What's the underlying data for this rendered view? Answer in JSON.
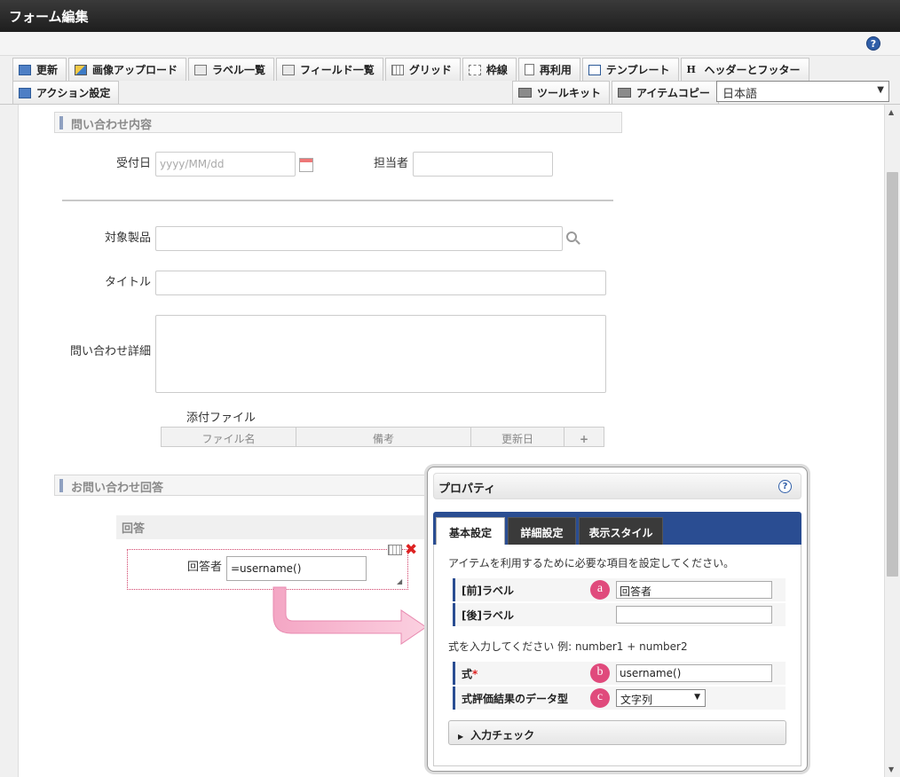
{
  "window": {
    "title": "フォーム編集"
  },
  "toolbar": {
    "row1": [
      {
        "label": "更新",
        "icon": "update-icon"
      },
      {
        "label": "画像アップロード",
        "icon": "image-upload-icon"
      },
      {
        "label": "ラベル一覧",
        "icon": "label-list-icon"
      },
      {
        "label": "フィールド一覧",
        "icon": "field-list-icon"
      },
      {
        "label": "グリッド",
        "icon": "grid-icon"
      },
      {
        "label": "枠線",
        "icon": "border-icon"
      },
      {
        "label": "再利用",
        "icon": "reuse-icon"
      },
      {
        "label": "テンプレート",
        "icon": "template-icon"
      },
      {
        "label": "ヘッダーとフッター",
        "icon": "header-footer-icon"
      }
    ],
    "row2_left": {
      "label": "アクション設定",
      "icon": "action-settings-icon"
    },
    "toolkit": "ツールキット",
    "item_copy": "アイテムコピー",
    "language": "日本語"
  },
  "form": {
    "section1": "問い合わせ内容",
    "received_date_label": "受付日",
    "received_date_placeholder": "yyyy/MM/dd",
    "person_in_charge_label": "担当者",
    "target_product_label": "対象製品",
    "title_label": "タイトル",
    "details_label": "問い合わせ詳細",
    "attachment_label": "添付ファイル",
    "attachment_columns": [
      "ファイル名",
      "備考",
      "更新日"
    ],
    "add_symbol": "+",
    "section2": "お問い合わせ回答",
    "answer_group": "回答",
    "responder_label": "回答者",
    "responder_value": "=username()"
  },
  "properties": {
    "title": "プロパティ",
    "help": "?",
    "tabs": [
      "基本設定",
      "詳細設定",
      "表示スタイル"
    ],
    "description": "アイテムを利用するために必要な項目を設定してください。",
    "front_label": "[前]ラベル",
    "front_label_value": "回答者",
    "back_label": "[後]ラベル",
    "back_label_value": "",
    "formula_hint": "式を入力してください 例: number1 + number2",
    "formula_label": "式",
    "formula_required": "*",
    "formula_value": "username()",
    "result_type_label": "式評価結果のデータ型",
    "result_type_value": "文字列",
    "badges": [
      "a",
      "b",
      "c"
    ],
    "input_check": "入力チェック"
  },
  "colors": {
    "accent": "#2a4d92",
    "badge": "#e04a7c",
    "titlebar": "#2a2a2a"
  }
}
